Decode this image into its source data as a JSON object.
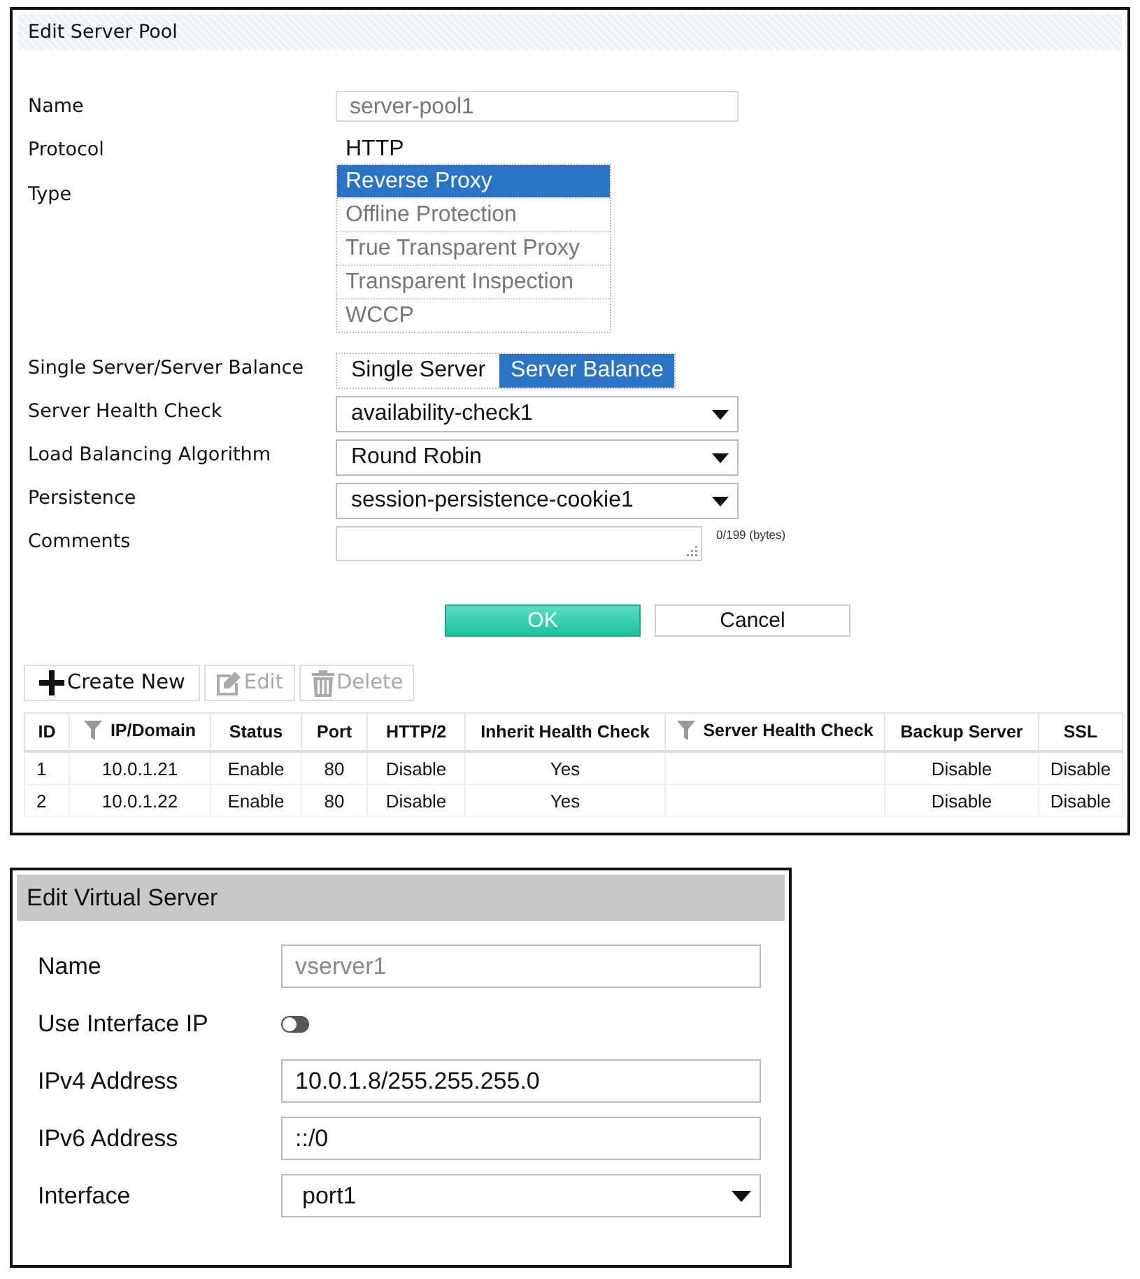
{
  "server_pool": {
    "title": "Edit Server Pool",
    "fields": [
      {
        "kind": "readonly",
        "label": "Name",
        "value": "server-pool1"
      },
      {
        "kind": "text",
        "label": "Protocol",
        "value": "HTTP"
      },
      {
        "kind": "listbox",
        "label": "Type",
        "options": [
          {
            "label": "Reverse Proxy",
            "selected": true
          },
          {
            "label": "Offline Protection",
            "selected": false
          },
          {
            "label": "True Transparent Proxy",
            "selected": false
          },
          {
            "label": "Transparent Inspection",
            "selected": false
          },
          {
            "label": "WCCP",
            "selected": false
          }
        ]
      },
      {
        "kind": "segmented",
        "label": "Single Server/Server Balance",
        "options": [
          {
            "label": "Single Server",
            "selected": false
          },
          {
            "label": "Server Balance",
            "selected": true
          }
        ]
      },
      {
        "kind": "select",
        "label": "Server Health Check",
        "value": "availability-check1"
      },
      {
        "kind": "select",
        "label": "Load Balancing Algorithm",
        "value": "Round Robin"
      },
      {
        "kind": "select",
        "label": "Persistence",
        "value": "session-persistence-cookie1"
      },
      {
        "kind": "textarea",
        "label": "Comments",
        "counter": "0/199 (bytes)"
      }
    ],
    "buttons": [
      {
        "label": "OK",
        "primary": true
      },
      {
        "label": "Cancel",
        "primary": false
      }
    ],
    "toolbar": [
      {
        "label": "Create New",
        "disabled": false
      },
      {
        "label": "Edit",
        "disabled": true
      },
      {
        "label": "Delete",
        "disabled": true
      }
    ],
    "table": {
      "columns": [
        {
          "label": "ID",
          "filter": false
        },
        {
          "label": "IP/Domain",
          "filter": true
        },
        {
          "label": "Status",
          "filter": false
        },
        {
          "label": "Port",
          "filter": false
        },
        {
          "label": "HTTP/2",
          "filter": false
        },
        {
          "label": "Inherit Health Check",
          "filter": false
        },
        {
          "label": "Server Health Check",
          "filter": true
        },
        {
          "label": "Backup Server",
          "filter": false
        },
        {
          "label": "SSL",
          "filter": false
        }
      ],
      "rows": [
        [
          "1",
          "10.0.1.21",
          "Enable",
          "80",
          "Disable",
          "Yes",
          "",
          "Disable",
          "Disable"
        ],
        [
          "2",
          "10.0.1.22",
          "Enable",
          "80",
          "Disable",
          "Yes",
          "",
          "Disable",
          "Disable"
        ]
      ]
    }
  },
  "virtual_server": {
    "title": "Edit Virtual Server",
    "fields": [
      {
        "kind": "readonly",
        "label": "Name",
        "value": "vserver1"
      },
      {
        "kind": "toggle",
        "label": "Use Interface IP",
        "on": false
      },
      {
        "kind": "input",
        "label": "IPv4 Address",
        "value": "10.0.1.8/255.255.255.0"
      },
      {
        "kind": "input",
        "label": "IPv6 Address",
        "value": "::/0"
      },
      {
        "kind": "select",
        "label": "Interface",
        "value": "port1"
      }
    ]
  }
}
